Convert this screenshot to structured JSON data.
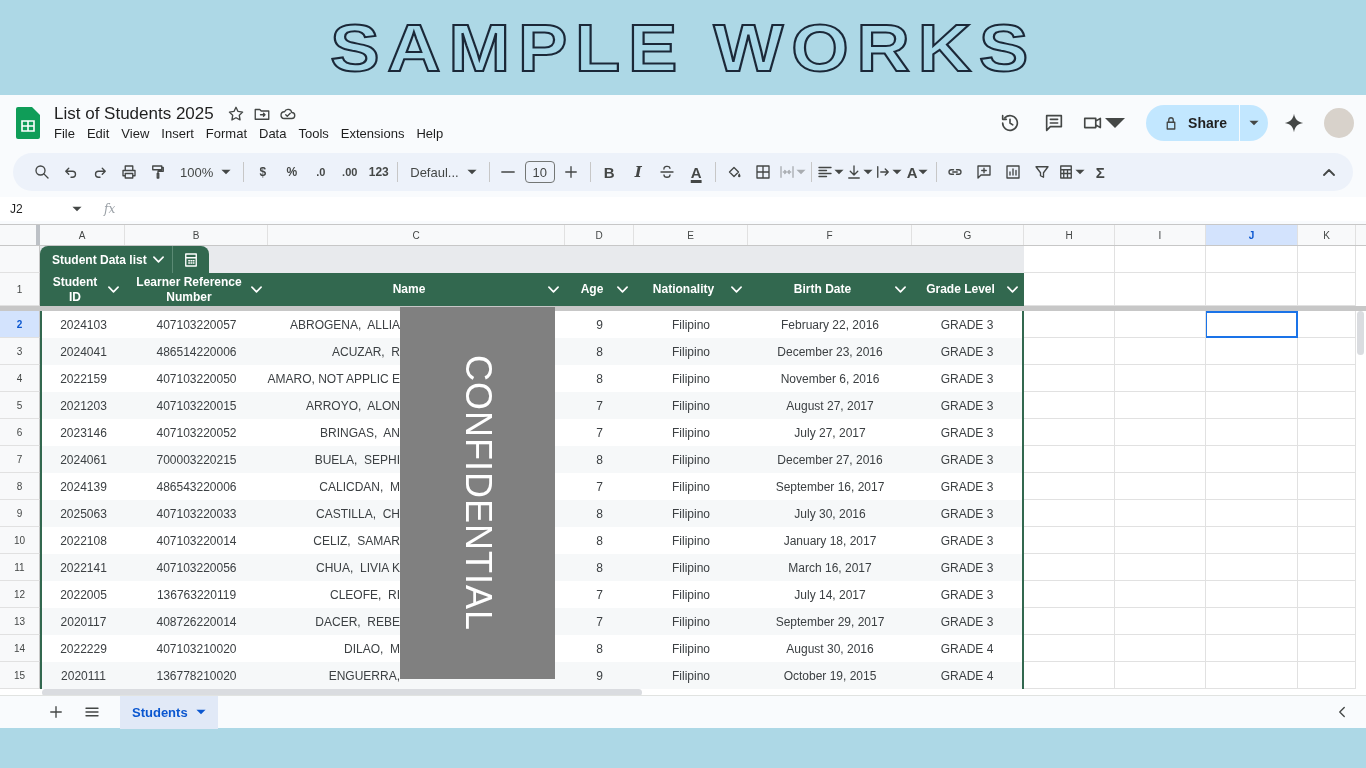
{
  "banner": {
    "title": "SAMPLE WORKS"
  },
  "document": {
    "title": "List of Students 2025",
    "menu": [
      "File",
      "Edit",
      "View",
      "Insert",
      "Format",
      "Data",
      "Tools",
      "Extensions",
      "Help"
    ],
    "share_label": "Share"
  },
  "toolbar": [
    {
      "kind": "search"
    },
    {
      "kind": "undo"
    },
    {
      "kind": "redo"
    },
    {
      "kind": "print"
    },
    {
      "kind": "paint"
    },
    {
      "kind": "dropdown",
      "text": "100%"
    },
    {
      "kind": "sep"
    },
    {
      "kind": "text",
      "text": "$"
    },
    {
      "kind": "text",
      "text": "%"
    },
    {
      "kind": "decimal",
      "text": ".0"
    },
    {
      "kind": "decimal",
      "text": ".00"
    },
    {
      "kind": "text",
      "text": "123"
    },
    {
      "kind": "sep"
    },
    {
      "kind": "dropdown",
      "text": "Defaul..."
    },
    {
      "kind": "sep"
    },
    {
      "kind": "minus"
    },
    {
      "kind": "stepper",
      "text": "10"
    },
    {
      "kind": "plus"
    },
    {
      "kind": "sep"
    },
    {
      "kind": "bold",
      "text": "B"
    },
    {
      "kind": "italic",
      "text": "I"
    },
    {
      "kind": "strike"
    },
    {
      "kind": "textcolor",
      "text": "A"
    },
    {
      "kind": "sep"
    },
    {
      "kind": "fill"
    },
    {
      "kind": "borders"
    },
    {
      "kind": "merge",
      "disabled": true,
      "caret": true
    },
    {
      "kind": "sep"
    },
    {
      "kind": "align",
      "caret": true
    },
    {
      "kind": "valign",
      "caret": true
    },
    {
      "kind": "wrap",
      "caret": true
    },
    {
      "kind": "rotate",
      "text": "A",
      "caret": true
    },
    {
      "kind": "sep"
    },
    {
      "kind": "link"
    },
    {
      "kind": "comment"
    },
    {
      "kind": "chart"
    },
    {
      "kind": "filter"
    },
    {
      "kind": "functions",
      "caret": true
    },
    {
      "kind": "sigma",
      "text": "Σ"
    }
  ],
  "formula_bar": {
    "cell_ref": "J2",
    "fx_label": "fx"
  },
  "column_letters": [
    {
      "label": "A",
      "selected": false
    },
    {
      "label": "B",
      "selected": false
    },
    {
      "label": "C",
      "selected": false
    },
    {
      "label": "D",
      "selected": false
    },
    {
      "label": "E",
      "selected": false
    },
    {
      "label": "F",
      "selected": false
    },
    {
      "label": "G",
      "selected": false
    },
    {
      "label": "H",
      "selected": false
    },
    {
      "label": "I",
      "selected": false
    },
    {
      "label": "J",
      "selected": true
    },
    {
      "label": "K",
      "selected": false
    }
  ],
  "table": {
    "name": "Student Data list",
    "header_row_number": "1",
    "columns": [
      "Student ID",
      "Learner Reference Number",
      "Name",
      "Age",
      "Nationality",
      "Birth Date",
      "Grade Level"
    ],
    "rows": [
      {
        "number": "2",
        "selected": true,
        "cells": [
          "2024103",
          "407103220057",
          "ABROGENA,  ALLIA",
          "9",
          "Filipino",
          "February 22, 2016",
          "GRADE 3"
        ]
      },
      {
        "number": "3",
        "selected": false,
        "cells": [
          "2024041",
          "486514220006",
          "ACUZAR,  R",
          "8",
          "Filipino",
          "December 23, 2016",
          "GRADE 3"
        ]
      },
      {
        "number": "4",
        "selected": false,
        "cells": [
          "2022159",
          "407103220050",
          "AMARO, NOT APPLIC E",
          "8",
          "Filipino",
          "November 6, 2016",
          "GRADE 3"
        ]
      },
      {
        "number": "5",
        "selected": false,
        "cells": [
          "2021203",
          "407103220015",
          "ARROYO,  ALON",
          "7",
          "Filipino",
          "August 27, 2017",
          "GRADE 3"
        ]
      },
      {
        "number": "6",
        "selected": false,
        "cells": [
          "2023146",
          "407103220052",
          "BRINGAS,  AN",
          "7",
          "Filipino",
          "July 27, 2017",
          "GRADE 3"
        ]
      },
      {
        "number": "7",
        "selected": false,
        "cells": [
          "2024061",
          "700003220215",
          "BUELA,  SEPHI",
          "8",
          "Filipino",
          "December 27, 2016",
          "GRADE 3"
        ]
      },
      {
        "number": "8",
        "selected": false,
        "cells": [
          "2024139",
          "486543220006",
          "CALICDAN,  M",
          "7",
          "Filipino",
          "September 16, 2017",
          "GRADE 3"
        ]
      },
      {
        "number": "9",
        "selected": false,
        "cells": [
          "2025063",
          "407103220033",
          "CASTILLA,  CH",
          "8",
          "Filipino",
          "July 30, 2016",
          "GRADE 3"
        ]
      },
      {
        "number": "10",
        "selected": false,
        "cells": [
          "2022108",
          "407103220014",
          "CELIZ,  SAMAR",
          "8",
          "Filipino",
          "January 18, 2017",
          "GRADE 3"
        ]
      },
      {
        "number": "11",
        "selected": false,
        "cells": [
          "2022141",
          "407103220056",
          "CHUA,  LIVIA K",
          "8",
          "Filipino",
          "March 16, 2017",
          "GRADE 3"
        ]
      },
      {
        "number": "12",
        "selected": false,
        "cells": [
          "2022005",
          "136763220119",
          "CLEOFE,  RI",
          "7",
          "Filipino",
          "July 14, 2017",
          "GRADE 3"
        ]
      },
      {
        "number": "13",
        "selected": false,
        "cells": [
          "2020117",
          "408726220014",
          "DACER,  REBE",
          "7",
          "Filipino",
          "September 29, 2017",
          "GRADE 3"
        ]
      },
      {
        "number": "14",
        "selected": false,
        "cells": [
          "2022229",
          "407103210020",
          "DILAO,  M",
          "8",
          "Filipino",
          "August 30, 2016",
          "GRADE 4"
        ]
      },
      {
        "number": "15",
        "selected": false,
        "cells": [
          "2020111",
          "136778210020",
          "ENGUERRA,",
          "9",
          "Filipino",
          "October 19, 2015",
          "GRADE 4"
        ]
      }
    ]
  },
  "overlay": {
    "text": "CONFIDENTIAL"
  },
  "sheet_tabs": [
    {
      "label": "Students",
      "selected": true
    }
  ]
}
